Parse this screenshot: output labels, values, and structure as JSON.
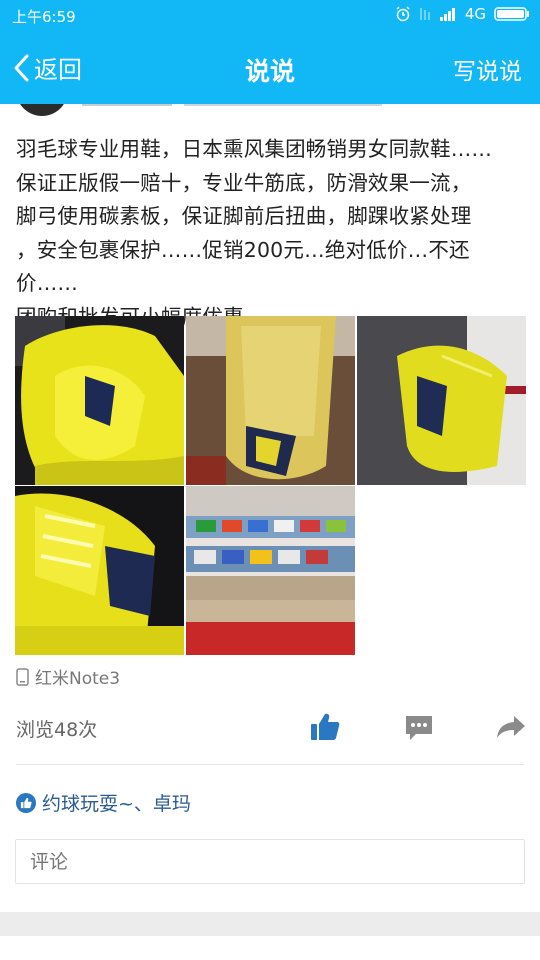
{
  "status_bar": {
    "time": "上午6:59",
    "network": "4G"
  },
  "nav": {
    "back_label": "返回",
    "title": "说说",
    "action_label": "写说说"
  },
  "post": {
    "text": "羽毛球专业用鞋，日本熏风集团畅销男女同款鞋……\n保证正版假一赔十，专业牛筋底，防滑效果一流，\n脚弓使用碳素板，保证脚前后扭曲，脚踝收紧处理\n，安全包裹保护……促销200元…绝对低价…不还价……\n团购和批发可小幅度优惠",
    "photos": [
      "shoe-side",
      "shoe-sole",
      "shoe-lace-side",
      "shoe-lace-top",
      "shoe-store-display"
    ],
    "device": "红米Note3"
  },
  "stats": {
    "views": "浏览48次"
  },
  "likes": {
    "names": "约球玩耍~、卓玛"
  },
  "comment": {
    "placeholder": "评论"
  },
  "colors": {
    "brand": "#12b7f5",
    "like_icon": "#2a78c2",
    "like_text": "#2a5c93"
  },
  "icons": [
    "back-chevron-icon",
    "alarm-icon",
    "signal-icon",
    "battery-icon",
    "phone-icon",
    "thumbs-up-icon",
    "comment-icon",
    "share-icon"
  ]
}
